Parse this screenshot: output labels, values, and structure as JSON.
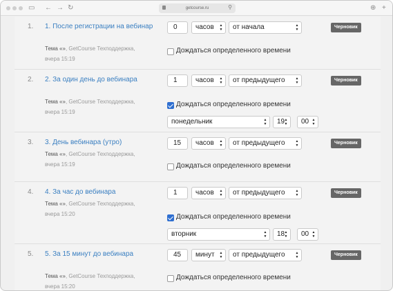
{
  "browser": {
    "url": "getcourse.ru"
  },
  "rows": [
    {
      "num": "1.",
      "title": "1. После регистрации на вебинар",
      "topic": "Тема «»",
      "author": ", GetCourse Техподдержка,",
      "time": "вчера 15:19",
      "amount": "0",
      "unit": "часов",
      "from": "от начала",
      "badge": "Черновик",
      "wait_label": "Дождаться определенного времени",
      "wait_checked": false
    },
    {
      "num": "2.",
      "title": "2. За один день до вебинара",
      "topic": "Тема «»",
      "author": ", GetCourse Техподдержка,",
      "time": "вчера 15:19",
      "amount": "1",
      "unit": "часов",
      "from": "от предыдущего",
      "badge": "Черновик",
      "wait_label": "Дождаться определенного времени",
      "wait_checked": true,
      "day": "понедельник",
      "hour": "19",
      "minute": "00"
    },
    {
      "num": "3.",
      "title": "3. День вебинара (утро)",
      "topic": "Тема «»",
      "author": ", GetCourse Техподдержка,",
      "time": "вчера 15:19",
      "amount": "15",
      "unit": "часов",
      "from": "от предыдущего",
      "badge": "Черновик",
      "wait_label": "Дождаться определенного времени",
      "wait_checked": false
    },
    {
      "num": "4.",
      "title": "4. За час до вебинара",
      "topic": "Тема «»",
      "author": ", GetCourse Техподдержка,",
      "time": "вчера 15:20",
      "amount": "1",
      "unit": "часов",
      "from": "от предыдущего",
      "badge": "Черновик",
      "wait_label": "Дождаться определенного времени",
      "wait_checked": true,
      "day": "вторник",
      "hour": "18",
      "minute": "00"
    },
    {
      "num": "5.",
      "title": "5. За 15 минут до вебинара",
      "topic": "Тема «»",
      "author": ", GetCourse Техподдержка,",
      "time": "вчера 15:20",
      "amount": "45",
      "unit": "минут",
      "from": "от предыдущего",
      "badge": "Черновик",
      "wait_label": "Дождаться определенного времени",
      "wait_checked": false
    }
  ]
}
